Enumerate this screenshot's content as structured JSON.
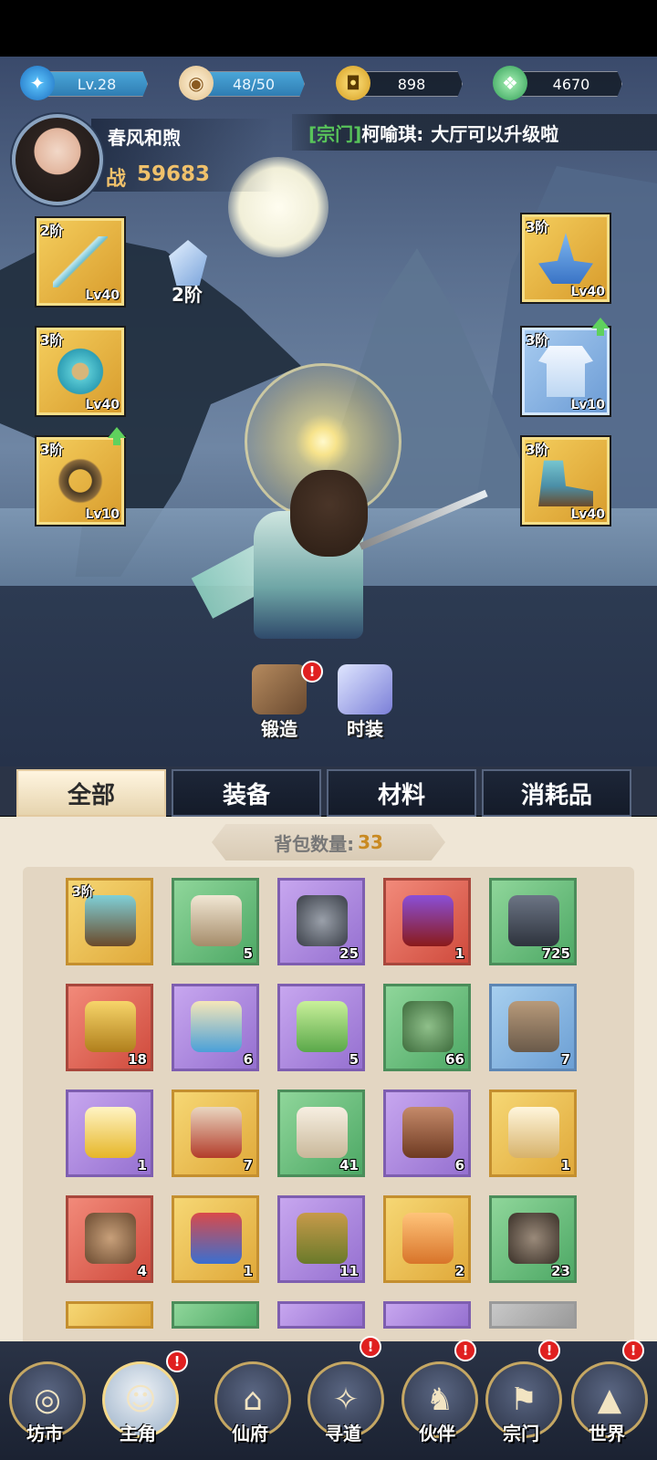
{
  "status": {
    "level": "Lv.28",
    "stamina": "48/50",
    "coins": "898",
    "jade": "4670"
  },
  "player": {
    "name": "春风和煦",
    "power_label": "战",
    "power_value": "59683"
  },
  "notice": {
    "tag": "[宗门]",
    "speaker": "柯喻琪:",
    "message": "大厅可以升级啦"
  },
  "equipment": {
    "weapon": {
      "tier": "2阶",
      "level": "Lv40"
    },
    "amulet": {
      "tier": "3阶",
      "level": "Lv40"
    },
    "ring": {
      "tier": "3阶",
      "level": "Lv10"
    },
    "headgear": {
      "tier": "3阶",
      "level": "Lv40"
    },
    "armor": {
      "tier": "3阶",
      "level": "Lv10"
    },
    "boots": {
      "tier": "3阶",
      "level": "Lv40"
    },
    "gem_tier": "2阶"
  },
  "actions": {
    "forge": "锻造",
    "fashion": "时装",
    "badge": "!"
  },
  "tabs": [
    "全部",
    "装备",
    "材料",
    "消耗品"
  ],
  "bag": {
    "label": "背包数量:",
    "count": "33"
  },
  "items": [
    {
      "icon": "boots-icon",
      "rarity": "gold",
      "tier": "3阶",
      "count": ""
    },
    {
      "icon": "book-icon",
      "rarity": "green",
      "tier": "",
      "count": "5"
    },
    {
      "icon": "stone-icon",
      "rarity": "purple",
      "tier": "",
      "count": "25"
    },
    {
      "icon": "orb-chest-icon",
      "rarity": "red",
      "tier": "",
      "count": "1"
    },
    {
      "icon": "ore-icon",
      "rarity": "green",
      "tier": "",
      "count": "725"
    },
    {
      "icon": "key-icon",
      "rarity": "red",
      "tier": "",
      "count": "18"
    },
    {
      "icon": "scroll-map-icon",
      "rarity": "purple",
      "tier": "",
      "count": "6"
    },
    {
      "icon": "scroll-green-icon",
      "rarity": "purple",
      "tier": "",
      "count": "5"
    },
    {
      "icon": "fruit-icon",
      "rarity": "green",
      "tier": "",
      "count": "66"
    },
    {
      "icon": "log-icon",
      "rarity": "blue",
      "tier": "",
      "count": "7"
    },
    {
      "icon": "cloud-charm-icon",
      "rarity": "purple",
      "tier": "",
      "count": "1"
    },
    {
      "icon": "scroll-red-icon",
      "rarity": "gold",
      "tier": "",
      "count": "7"
    },
    {
      "icon": "scroll-open-icon",
      "rarity": "green",
      "tier": "",
      "count": "41"
    },
    {
      "icon": "manual-icon",
      "rarity": "purple",
      "tier": "",
      "count": "6"
    },
    {
      "icon": "box-icon",
      "rarity": "gold",
      "tier": "",
      "count": "1"
    },
    {
      "icon": "token-icon",
      "rarity": "red",
      "tier": "",
      "count": "4"
    },
    {
      "icon": "card-icon",
      "rarity": "gold",
      "tier": "",
      "count": "1"
    },
    {
      "icon": "leaf-icon",
      "rarity": "purple",
      "tier": "",
      "count": "11"
    },
    {
      "icon": "ginseng-icon",
      "rarity": "gold",
      "tier": "",
      "count": "2"
    },
    {
      "icon": "balls-icon",
      "rarity": "green",
      "tier": "",
      "count": "23"
    }
  ],
  "nav": [
    "坊市",
    "主角",
    "仙府",
    "寻道",
    "伙伴",
    "宗门",
    "世界"
  ],
  "colors": {
    "gold_text": "#f0c16b",
    "notice_tag": "#58c45a",
    "bag_count": "#c98a22",
    "badge_red": "#e02020"
  }
}
